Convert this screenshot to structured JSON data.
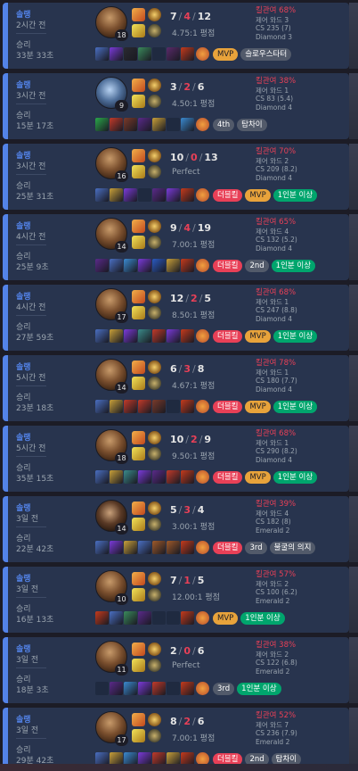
{
  "accent_colors": {
    "win_border": "#5383e8",
    "kill_participation": "#e84057",
    "mvp": "#e8a33b",
    "good_badge": "#00a56d",
    "multi_kill": "#e84057"
  },
  "matches": [
    {
      "queue": "솔랭",
      "ago": "2시간 전",
      "result": "승리",
      "duration": "33분 33초",
      "level": "18",
      "champion_style": "warm",
      "kills": "7",
      "deaths": "4",
      "assists": "12",
      "kda_ratio": "4.75:1 평점",
      "kill_participation": "킬관여 68%",
      "control_wards": "제어 와드 3",
      "cs": "CS 235 (7)",
      "tier": "Diamond 3",
      "items": [
        "#4a6fc2",
        "#7a3ad8",
        "#2a2a30",
        "#3a8a5c",
        "empty",
        "#5a2a6a",
        "#c53a1c"
      ],
      "ward": "#b84a2a",
      "tags": [
        {
          "text": "MVP",
          "kind": "mvp"
        },
        {
          "text": "슬로우스타터",
          "kind": "gray"
        }
      ]
    },
    {
      "queue": "솔랭",
      "ago": "3시간 전",
      "result": "승리",
      "duration": "15분 17초",
      "level": "9",
      "champion_style": "blue",
      "kills": "3",
      "deaths": "2",
      "assists": "6",
      "kda_ratio": "4.50:1 평점",
      "kill_participation": "킬관여 38%",
      "control_wards": "제어 와드 1",
      "cs": "CS 83 (5.4)",
      "tier": "Diamond 4",
      "items": [
        "#2aa84a",
        "#c23a2a",
        "#7a3a2a",
        "#5a2a8a",
        "#c8a03a",
        "empty",
        "#3a8ad0"
      ],
      "ward": "#b84a2a",
      "tags": [
        {
          "text": "4th",
          "kind": "gray"
        },
        {
          "text": "탐차이",
          "kind": "gray"
        }
      ]
    },
    {
      "queue": "솔랭",
      "ago": "3시간 전",
      "result": "승리",
      "duration": "25분 31초",
      "level": "16",
      "champion_style": "warm",
      "kills": "10",
      "deaths": "0",
      "assists": "13",
      "kda_ratio": "Perfect",
      "kill_participation": "킬관여 70%",
      "control_wards": "제어 와드 2",
      "cs": "CS 209 (8.2)",
      "tier": "Diamond 4",
      "items": [
        "#4a6fc2",
        "#c8a03a",
        "#7a3ad8",
        "empty",
        "#5a2a8a",
        "#7a3ad8",
        "#c53a1c"
      ],
      "ward": "#b84a2a",
      "tags": [
        {
          "text": "더블킬",
          "kind": "red"
        },
        {
          "text": "MVP",
          "kind": "mvp"
        },
        {
          "text": "1인분 이상",
          "kind": "green"
        }
      ]
    },
    {
      "queue": "솔랭",
      "ago": "4시간 전",
      "result": "승리",
      "duration": "25분 9초",
      "level": "14",
      "champion_style": "warm",
      "kills": "9",
      "deaths": "4",
      "assists": "19",
      "kda_ratio": "7.00:1 평점",
      "kill_participation": "킬관여 65%",
      "control_wards": "제어 와드 4",
      "cs": "CS 132 (5.2)",
      "tier": "Diamond 4",
      "items": [
        "#5a2a8a",
        "#4a6fc2",
        "#3a8ad0",
        "#7a3ad8",
        "#2a5ac2",
        "#c8a03a",
        "#c53a1c"
      ],
      "ward": "#b84a2a",
      "tags": [
        {
          "text": "더블킬",
          "kind": "red"
        },
        {
          "text": "2nd",
          "kind": "gray"
        },
        {
          "text": "1인분 이상",
          "kind": "green"
        }
      ]
    },
    {
      "queue": "솔랭",
      "ago": "4시간 전",
      "result": "승리",
      "duration": "27분 59초",
      "level": "17",
      "champion_style": "warm",
      "kills": "12",
      "deaths": "2",
      "assists": "5",
      "kda_ratio": "8.50:1 평점",
      "kill_participation": "킬관여 68%",
      "control_wards": "제어 와드 1",
      "cs": "CS 247 (8.8)",
      "tier": "Diamond 4",
      "items": [
        "#4a6fc2",
        "#c8a03a",
        "#7a3ad8",
        "#3a8a8a",
        "#c23a2a",
        "#7a3ad8",
        "#c53a1c"
      ],
      "ward": "#b84a2a",
      "tags": [
        {
          "text": "더블킬",
          "kind": "red"
        },
        {
          "text": "MVP",
          "kind": "mvp"
        },
        {
          "text": "1인분 이상",
          "kind": "green"
        }
      ]
    },
    {
      "queue": "솔랭",
      "ago": "5시간 전",
      "result": "승리",
      "duration": "23분 18초",
      "level": "14",
      "champion_style": "warm",
      "kills": "6",
      "deaths": "3",
      "assists": "8",
      "kda_ratio": "4.67:1 평점",
      "kill_participation": "킬관여 78%",
      "control_wards": "제어 와드 1",
      "cs": "CS 180 (7.7)",
      "tier": "Diamond 4",
      "items": [
        "#4a6fc2",
        "#c8a03a",
        "#c23a2a",
        "#c23a2a",
        "#7a3a2a",
        "empty",
        "#c53a1c"
      ],
      "ward": "#b84a2a",
      "tags": [
        {
          "text": "더블킬",
          "kind": "red"
        },
        {
          "text": "MVP",
          "kind": "mvp"
        },
        {
          "text": "1인분 이상",
          "kind": "green"
        }
      ]
    },
    {
      "queue": "솔랭",
      "ago": "5시간 전",
      "result": "승리",
      "duration": "35분 15초",
      "level": "18",
      "champion_style": "warm",
      "kills": "10",
      "deaths": "2",
      "assists": "9",
      "kda_ratio": "9.50:1 평점",
      "kill_participation": "킬관여 68%",
      "control_wards": "제어 와드 1",
      "cs": "CS 290 (8.2)",
      "tier": "Diamond 4",
      "items": [
        "#4a6fc2",
        "#c8a03a",
        "#3a8a8a",
        "#7a3ad8",
        "#5a2a8a",
        "#c23a2a",
        "#c53a1c"
      ],
      "ward": "#b84a2a",
      "tags": [
        {
          "text": "더블킬",
          "kind": "red"
        },
        {
          "text": "MVP",
          "kind": "mvp"
        },
        {
          "text": "1인분 이상",
          "kind": "green"
        }
      ]
    },
    {
      "queue": "솔랭",
      "ago": "3일 전",
      "result": "승리",
      "duration": "22분 42초",
      "level": "14",
      "champion_style": "dark",
      "kills": "5",
      "deaths": "3",
      "assists": "4",
      "kda_ratio": "3.00:1 평점",
      "kill_participation": "킬관여 39%",
      "control_wards": "제어 와드 4",
      "cs": "CS 182 (8)",
      "tier": "Emerald 2",
      "items": [
        "#4a6fc2",
        "#7a3ad8",
        "#c8a03a",
        "#4a6fc2",
        "#a05a2a",
        "#a05a2a",
        "#c53a1c"
      ],
      "ward": "#b84a2a",
      "tags": [
        {
          "text": "더블킬",
          "kind": "red"
        },
        {
          "text": "3rd",
          "kind": "gray"
        },
        {
          "text": "불굴의 의지",
          "kind": "gray"
        }
      ]
    },
    {
      "queue": "솔랭",
      "ago": "3일 전",
      "result": "승리",
      "duration": "16분 13초",
      "level": "10",
      "champion_style": "warm",
      "kills": "7",
      "deaths": "1",
      "assists": "5",
      "kda_ratio": "12.00:1 평점",
      "kill_participation": "킬관여 57%",
      "control_wards": "제어 와드 2",
      "cs": "CS 100 (6.2)",
      "tier": "Emerald 2",
      "items": [
        "#c53a1c",
        "#4a6fc2",
        "#3a8a5c",
        "#5a2a8a",
        "empty",
        "empty",
        "#c53a1c"
      ],
      "ward": "#b84a2a",
      "tags": [
        {
          "text": "MVP",
          "kind": "mvp"
        },
        {
          "text": "1인분 이상",
          "kind": "green"
        }
      ]
    },
    {
      "queue": "솔랭",
      "ago": "3일 전",
      "result": "승리",
      "duration": "18분 3초",
      "level": "11",
      "champion_style": "warm",
      "kills": "2",
      "deaths": "0",
      "assists": "6",
      "kda_ratio": "Perfect",
      "kill_participation": "킬관여 38%",
      "control_wards": "제어 와드 2",
      "cs": "CS 122 (6.8)",
      "tier": "Emerald 2",
      "items": [
        "empty",
        "#5a2a8a",
        "#3a8ad0",
        "#7a3ad8",
        "#c23a2a",
        "empty",
        "#c53a1c"
      ],
      "ward": "#b84a2a",
      "tags": [
        {
          "text": "3rd",
          "kind": "gray"
        },
        {
          "text": "1인분 이상",
          "kind": "green"
        }
      ]
    },
    {
      "queue": "솔랭",
      "ago": "3일 전",
      "result": "승리",
      "duration": "29분 42초",
      "level": "17",
      "champion_style": "warm",
      "kills": "8",
      "deaths": "2",
      "assists": "6",
      "kda_ratio": "7.00:1 평점",
      "kill_participation": "킬관여 52%",
      "control_wards": "제어 와드 7",
      "cs": "CS 236 (7.9)",
      "tier": "Emerald 2",
      "items": [
        "#4a6fc2",
        "#c8a03a",
        "#3a8ad0",
        "#7a3ad8",
        "#c23a2a",
        "#c8a03a",
        "#c53a1c"
      ],
      "ward": "#b84a2a",
      "tags": [
        {
          "text": "더블킬",
          "kind": "red"
        },
        {
          "text": "2nd",
          "kind": "gray"
        },
        {
          "text": "탐차이",
          "kind": "gray"
        }
      ]
    }
  ]
}
